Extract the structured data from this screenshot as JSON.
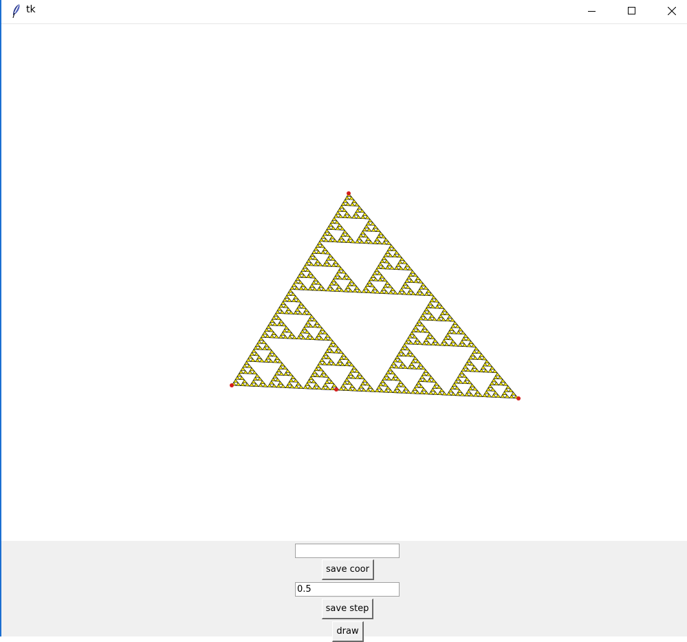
{
  "window": {
    "title": "tk",
    "controls": [
      "minimize-icon",
      "maximize-icon",
      "close-icon"
    ]
  },
  "canvas": {
    "background": "#ffffff",
    "fractal": "sierpinski-triangle",
    "fill_color": "#f2e600",
    "outline_color": "#000000",
    "vertex_color": "#d41e1e"
  },
  "controls": {
    "coor_input_value": "",
    "save_coor_label": "save coor",
    "step_input_value": "0.5",
    "save_step_label": "save step",
    "draw_label": "draw"
  },
  "colors": {
    "panel_bg": "#f0f0f0",
    "window_border": "#1c6fd1"
  }
}
